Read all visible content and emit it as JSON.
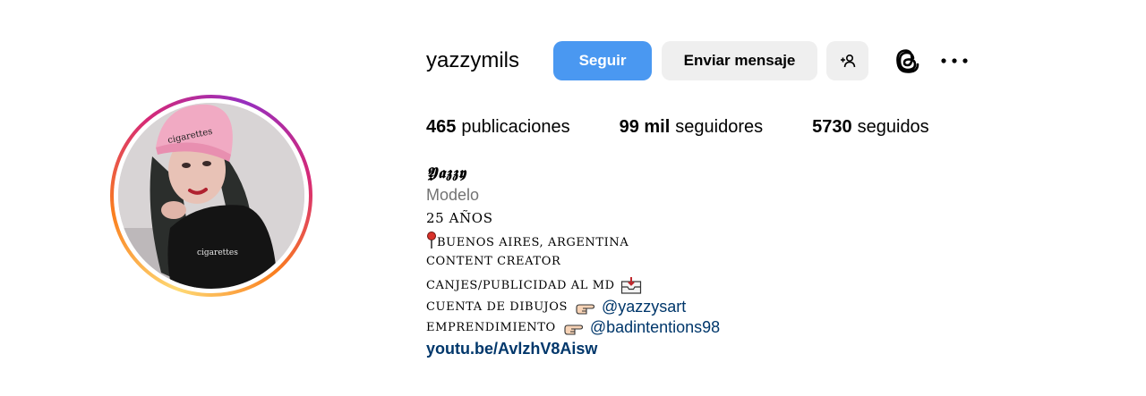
{
  "profile": {
    "username": "yazzymils",
    "follow_label": "Seguir",
    "message_label": "Enviar mensaje",
    "suggest_icon": "person-add-icon",
    "threads_icon": "threads-icon",
    "more_icon": "more-options-icon"
  },
  "stats": {
    "posts_count": "465",
    "posts_label": "publicaciones",
    "followers_count": "99 mil",
    "followers_label": "seguidores",
    "following_count": "5730",
    "following_label": "seguidos"
  },
  "bio": {
    "name": "𝖄𝖆𝖟𝖟𝖞",
    "category": "Modelo",
    "lines": [
      "25 AÑOS",
      "BUENOS AIRES, ARGENTINA",
      "CONTENT CREATOR",
      "CANJES/PUBLICIDAD AL MD",
      "CUENTA DE DIBUJOS",
      "EMPRENDIMIENTO"
    ],
    "mention_drawings": "@yazzysart",
    "mention_business": "@badintentions98",
    "link": "youtu.be/AvlzhV8Aisw"
  },
  "colors": {
    "follow_button": "#4a98f1",
    "secondary_button": "#efefef",
    "link": "#00376b",
    "category": "#737373"
  }
}
